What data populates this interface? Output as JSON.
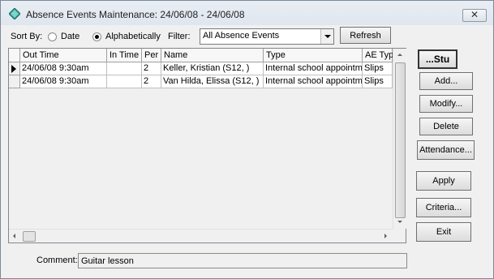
{
  "window": {
    "title": "Absence Events Maintenance: 24/06/08 - 24/06/08"
  },
  "sort": {
    "label": "Sort By:",
    "options": [
      {
        "label": "Date",
        "selected": false
      },
      {
        "label": "Alphabetically",
        "selected": true
      }
    ]
  },
  "filter": {
    "label": "Filter:",
    "value": "All Absence Events"
  },
  "buttons": {
    "refresh": "Refresh",
    "student": "...Stu",
    "add": "Add...",
    "modify": "Modify...",
    "delete": "Delete",
    "attendance": "Attendance...",
    "apply": "Apply",
    "criteria": "Criteria...",
    "exit": "Exit"
  },
  "grid": {
    "columns": [
      "Out Time",
      "In Time",
      "Per",
      "Name",
      "Type",
      "AE Typ"
    ],
    "rows": [
      {
        "out_time": "24/06/08 9:30am",
        "in_time": "",
        "per": "2",
        "name": "Keller, Kristian (S12, )",
        "type": "Internal school appointme",
        "ae_type": "Slips",
        "current": true
      },
      {
        "out_time": "24/06/08 9:30am",
        "in_time": "",
        "per": "2",
        "name": "Van Hilda, Elissa (S12, )",
        "type": "Internal school appointme",
        "ae_type": "Slips",
        "current": false
      }
    ]
  },
  "comment": {
    "label": "Comment:",
    "value": "Guitar lesson"
  },
  "colors": {
    "window_bg": "#f0f0f0",
    "title_bg": "#dfe6ee",
    "grid_bg": "#ffffff"
  }
}
